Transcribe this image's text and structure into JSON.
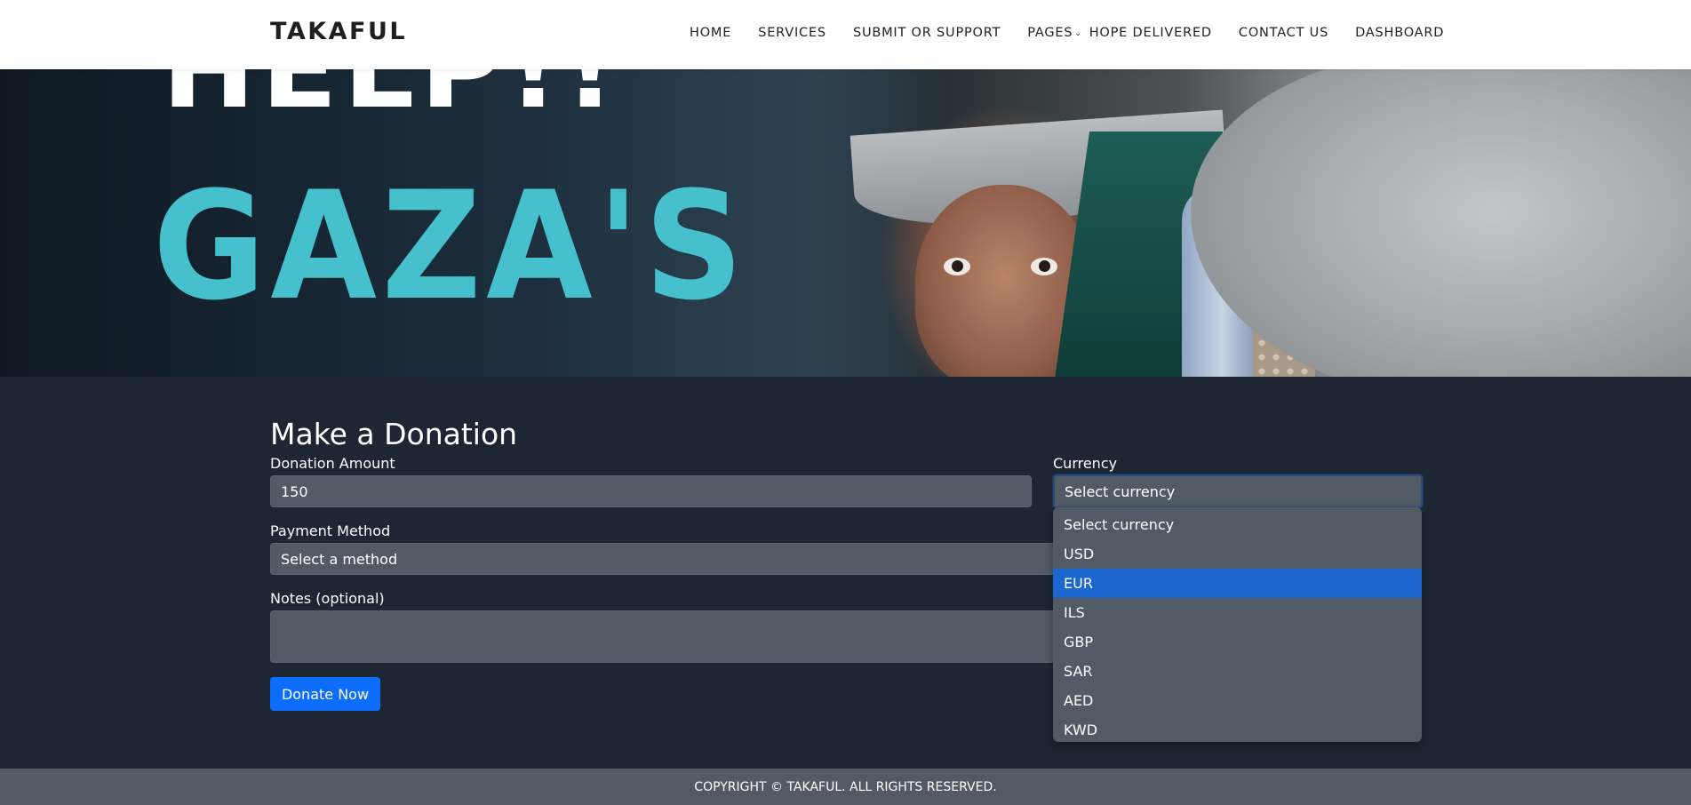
{
  "header": {
    "brand": "TAKAFUL",
    "nav": [
      {
        "label": "HOME"
      },
      {
        "label": "SERVICES"
      },
      {
        "label": "SUBMIT OR SUPPORT"
      },
      {
        "label": "PAGES"
      },
      {
        "label": "HOPE DELIVERED"
      },
      {
        "label": "CONTACT US"
      },
      {
        "label": "DASHBOARD"
      }
    ]
  },
  "hero": {
    "line1": "HELP!!",
    "line2": "GAZA'S"
  },
  "form": {
    "title": "Make a Donation",
    "amount_label": "Donation Amount",
    "amount_value": "150",
    "currency_label": "Currency",
    "currency_value": "Select currency",
    "payment_label": "Payment Method",
    "payment_value": "Select a method",
    "notes_label": "Notes (optional)",
    "notes_value": "",
    "submit_label": "Donate Now"
  },
  "currency_dropdown": {
    "options": [
      "Select currency",
      "USD",
      "EUR",
      "ILS",
      "GBP",
      "SAR",
      "AED",
      "KWD"
    ],
    "highlighted": "EUR"
  },
  "footer": {
    "copyright": "COPYRIGHT © TAKAFUL. ALL RIGHTS RESERVED."
  },
  "colors": {
    "accent": "#0d6efd",
    "highlight": "#1c66d0",
    "page_bg": "#1e2633",
    "field_bg": "#525a66"
  }
}
